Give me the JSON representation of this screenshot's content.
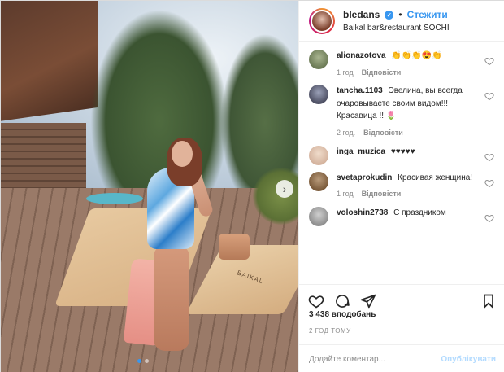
{
  "post": {
    "username": "bledans",
    "verified": true,
    "follow_label": "Стежити",
    "separator": "•",
    "location": "Baikal bar&restaurant SOCHI",
    "photo": {
      "lounger_label": "BAIKAL",
      "carousel_dots": 2,
      "active_dot": 0
    }
  },
  "comments": [
    {
      "user": "alionazotova",
      "text": "👏👏👏😍👏",
      "time": "1 год",
      "reply": "Відповісти",
      "avatar_color": "#6b7a55"
    },
    {
      "user": "tancha.1103",
      "text": "Эвелина, вы всегда очаровываете своим видом!!! Красавица !! 🌷",
      "time": "2 год.",
      "reply": "Відповісти",
      "avatar_color": "#4d4f63"
    },
    {
      "user": "inga_muzica",
      "text": "♥♥♥♥♥",
      "time": "",
      "reply": "",
      "avatar_color": "#d4b39e"
    },
    {
      "user": "svetaprokudin",
      "text": "Красивая женщина!",
      "time": "1 год",
      "reply": "Відповісти",
      "avatar_color": "#7a5a3a"
    },
    {
      "user": "voloshin2738",
      "text": "С праздником",
      "time": "",
      "reply": "",
      "avatar_color": "#8f8f8f"
    }
  ],
  "stats": {
    "likes": "3 438 вподобань",
    "posted": "2 ГОД ТОМУ"
  },
  "composer": {
    "placeholder": "Додайте коментар...",
    "publish_label": "Опублікувати"
  }
}
